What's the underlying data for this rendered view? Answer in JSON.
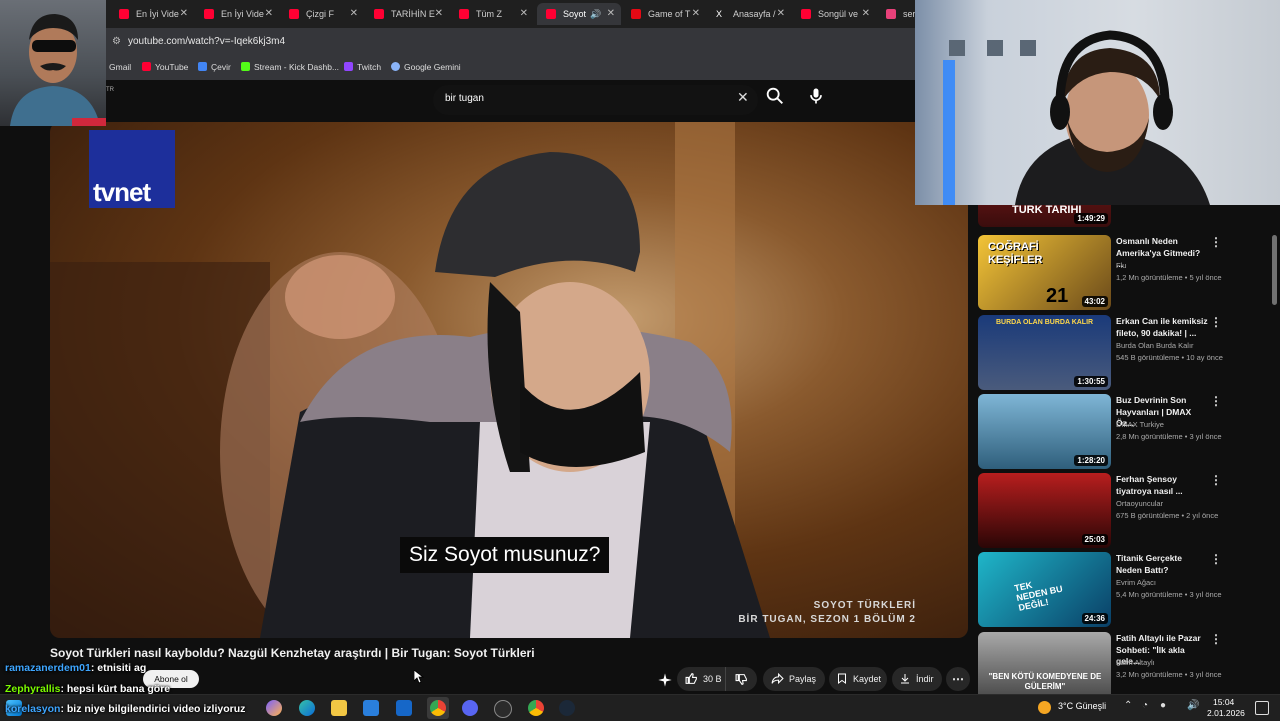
{
  "browser": {
    "tabs": [
      "En İyi Vide",
      "En İyi Vide",
      "Çizgi F",
      "TARİHİN E",
      "Tüm Z",
      "Soyot",
      "Game of T",
      "Anasayfa /",
      "Songül ve",
      "serh"
    ],
    "active_tab_index": 5,
    "url": "youtube.com/watch?v=-Iqek6kj3m4",
    "bookmarks": [
      "Gmail",
      "YouTube",
      "Çevir",
      "Stream - Kick Dashb...",
      "Twitch",
      "Google Gemini"
    ],
    "region_code": "TR"
  },
  "search": {
    "query": "bir tugan"
  },
  "video": {
    "channel_logo": "tvnet",
    "subtitle": "Siz Soyot musunuz?",
    "corner_line1": "SOYOT TÜRKLERİ",
    "corner_line2": "BİR TUGAN, SEZON 1 BÖLÜM 2",
    "title": "Soyot Türkleri nasıl kayboldu? Nazgül Kenzhetay araştırdı | Bir Tugan: Soyot Türkleri",
    "subscribe_label": "Abone ol",
    "likes": "30 B",
    "share": "Paylaş",
    "save": "Kaydet",
    "download": "İndir"
  },
  "chat": [
    {
      "user": "ramazanerdem01",
      "text": ": etnisiti ag",
      "color": "#3ea6ff"
    },
    {
      "user": "Zephyrallis",
      "text": ": hepsi kürt bana göre",
      "color": "#7CFC00"
    },
    {
      "user": "korelasyon",
      "text": ": biz niye bilgilendirici video izliyoruz",
      "color": "#3ea6ff"
    }
  ],
  "recommendations": [
    {
      "title": "",
      "channel": "",
      "meta": "",
      "duration": "1:49:29",
      "thumb_text": "TÜRK TARİHİ"
    },
    {
      "title": "Osmanlı Neden Amerika'ya Gitmedi? ...",
      "channel": "Flu",
      "meta": "1,2 Mn görüntüleme • 5 yıl önce",
      "duration": "43:02",
      "thumb_text": "COĞRAFİ KEŞİFLER"
    },
    {
      "title": "Erkan Can ile kemiksiz fileto, 90 dakika! | ...",
      "channel": "Burda Olan Burda Kalır",
      "meta": "545 B görüntüleme • 10 ay önce",
      "duration": "1:30:55",
      "thumb_text": "BURDA OLAN BURDA KALIR"
    },
    {
      "title": "Buz Devrinin Son Hayvanları | DMAX Öz...",
      "channel": "DMAX Turkiye",
      "meta": "2,8 Mn görüntüleme • 3 yıl önce",
      "duration": "1:28:20",
      "thumb_text": ""
    },
    {
      "title": "Ferhan Şensoy tiyatroya nasıl ...",
      "channel": "Ortaoyuncular",
      "meta": "675 B görüntüleme • 2 yıl önce",
      "duration": "25:03",
      "thumb_text": ""
    },
    {
      "title": "Titanik Gerçekte Neden Battı?",
      "channel": "Evrim Ağacı",
      "meta": "5,4 Mn görüntüleme • 3 yıl önce",
      "duration": "24:36",
      "thumb_text": "TEK NEDEN BU DEĞİL!"
    },
    {
      "title": "Fatih Altaylı ile Pazar Sohbeti: \"İlk akla gele...",
      "channel": "Fatih Altaylı",
      "meta": "3,2 Mn görüntüleme • 3 yıl önce",
      "duration": "",
      "thumb_text": "\"BEN KÖTÜ KOMEDYENE DE GÜLERİM\""
    }
  ],
  "taskbar": {
    "weather": "3°C Güneşli",
    "time": "15:04",
    "date": "2.01.2026"
  },
  "colors": {
    "youtube_red": "#ff0033",
    "accent_blue": "#3ea6ff"
  }
}
